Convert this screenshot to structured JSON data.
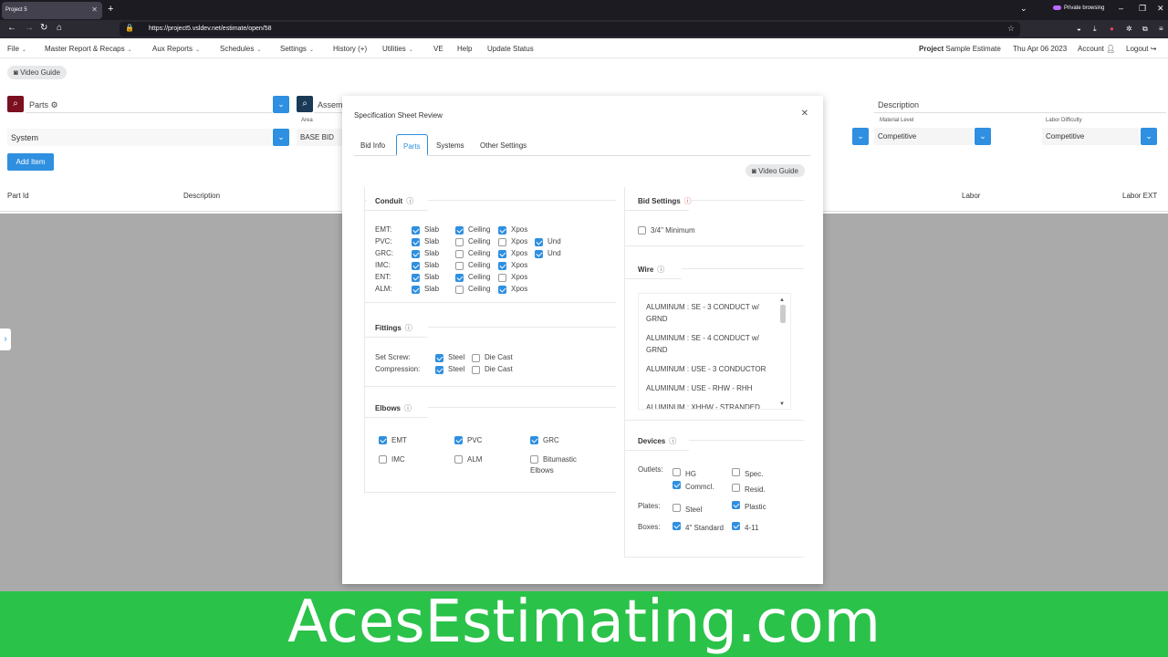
{
  "browser": {
    "tab_title": "Project 5",
    "url": "https://project5.vsldev.net/estimate/open/58",
    "private_label": "Private browsing"
  },
  "menu": {
    "items": [
      "File",
      "Master Report & Recaps",
      "Aux Reports",
      "Schedules",
      "Settings",
      "History (+)",
      "Utilities",
      "VE",
      "Help",
      "Update Status"
    ],
    "project_label": "Project",
    "project_name": "Sample Estimate",
    "date": "Thu Apr 06 2023",
    "account": "Account",
    "logout": "Logout"
  },
  "video_guide": "Video Guide",
  "page": {
    "parts_label": "Parts",
    "assemblies_label": "Assem",
    "area_label": "Area",
    "area_value": "BASE BID",
    "system_value": "System",
    "description_label": "Description",
    "material_level_label": "Material Level",
    "material_level_value": "Competitive",
    "labor_difficulty_label": "Labor Difficulty",
    "labor_difficulty_value": "Competitive",
    "add_item": "Add Item",
    "columns": {
      "part_id": "Part Id",
      "description": "Description",
      "labor": "Labor",
      "labor_ext": "Labor EXT"
    }
  },
  "modal": {
    "title": "Specification Sheet Review",
    "tabs": [
      "Bid Info",
      "Parts",
      "Systems",
      "Other Settings"
    ],
    "active_tab": "Parts",
    "video_guide": "Video Guide",
    "conduit": {
      "title": "Conduit",
      "rows": [
        {
          "label": "EMT:",
          "slab": true,
          "ceiling": true,
          "xpos": true,
          "und": null
        },
        {
          "label": "PVC:",
          "slab": true,
          "ceiling": false,
          "xpos": false,
          "und": true
        },
        {
          "label": "GRC:",
          "slab": true,
          "ceiling": false,
          "xpos": true,
          "und": true
        },
        {
          "label": "IMC:",
          "slab": true,
          "ceiling": false,
          "xpos": true,
          "und": null
        },
        {
          "label": "ENT:",
          "slab": true,
          "ceiling": true,
          "xpos": false,
          "und": null
        },
        {
          "label": "ALM:",
          "slab": true,
          "ceiling": false,
          "xpos": true,
          "und": null
        }
      ],
      "slab": "Slab",
      "ceiling": "Ceiling",
      "xpos": "Xpos",
      "und": "Und"
    },
    "fittings": {
      "title": "Fittings",
      "rows": [
        {
          "label": "Set Screw:",
          "steel": true,
          "die_cast": false
        },
        {
          "label": "Compression:",
          "steel": true,
          "die_cast": false
        }
      ],
      "steel": "Steel",
      "die_cast": "Die Cast"
    },
    "elbows": {
      "title": "Elbows",
      "emt": "EMT",
      "emt_on": true,
      "pvc": "PVC",
      "pvc_on": true,
      "grc": "GRC",
      "grc_on": true,
      "imc": "IMC",
      "imc_on": false,
      "alm": "ALM",
      "alm_on": false,
      "bitumastic": "Bitumastic Elbows",
      "bitumastic_on": false
    },
    "bid_settings": {
      "title": "Bid Settings",
      "min_label": "3/4\" Minimum",
      "min_on": false
    },
    "wire": {
      "title": "Wire",
      "items": [
        "ALUMINUM : SE - 3 CONDUCT w/ GRND",
        "ALUMINUM : SE - 4 CONDUCT w/ GRND",
        "ALUMINUM : USE - 3 CONDUCTOR",
        "ALUMINUM : USE - RHW - RHH",
        "ALUMINUM : XHHW - STRANDED"
      ]
    },
    "devices": {
      "title": "Devices",
      "outlets_label": "Outlets:",
      "plates_label": "Plates:",
      "boxes_label": "Boxes:",
      "hg": "HG",
      "hg_on": false,
      "spec": "Spec.",
      "spec_on": false,
      "commcl": "Commcl.",
      "commcl_on": true,
      "resid": "Resid.",
      "resid_on": false,
      "steel": "Steel",
      "steel_on": false,
      "plastic": "Plastic",
      "plastic_on": true,
      "four": "4\" Standard",
      "four_on": true,
      "four11": "4-11",
      "four11_on": true
    }
  },
  "banner": "AcesEstimating.com"
}
